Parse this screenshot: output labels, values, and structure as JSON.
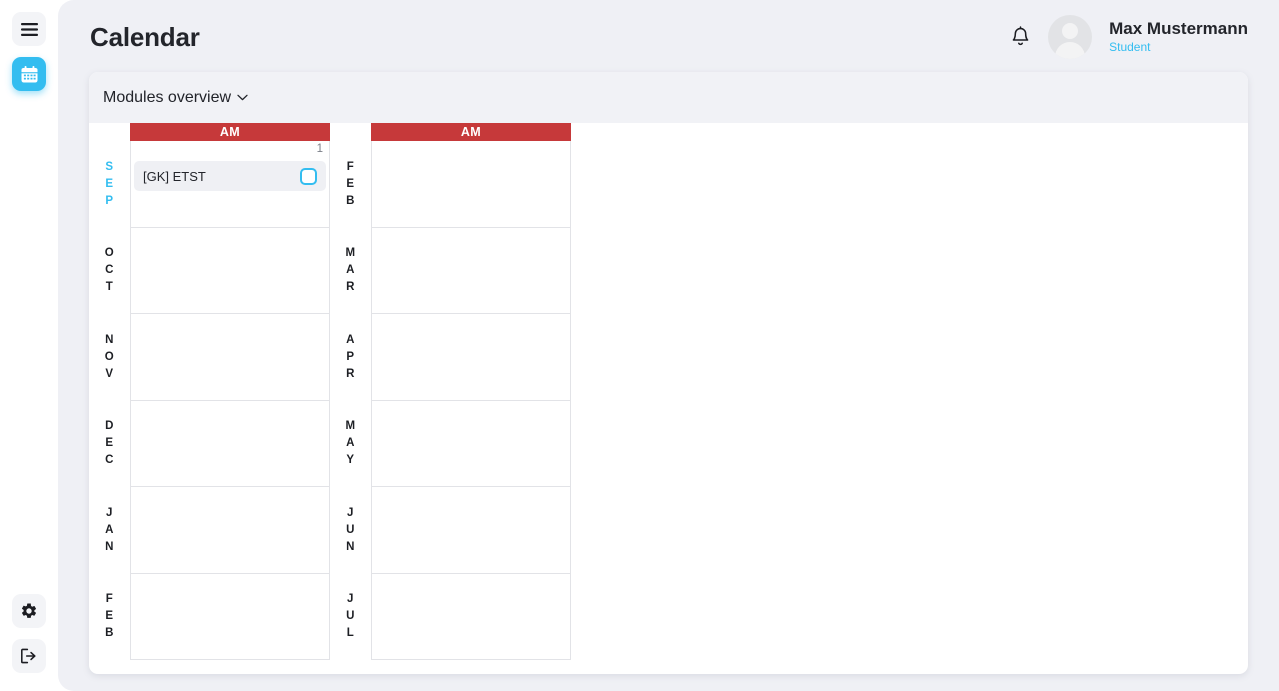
{
  "sidebar": {
    "top_items": [
      {
        "name": "menu-toggle",
        "icon": "hamburger-menu-icon",
        "active": false
      },
      {
        "name": "calendar",
        "icon": "calendar-icon",
        "active": true
      }
    ],
    "bottom_items": [
      {
        "name": "settings",
        "icon": "gear-icon",
        "active": false
      },
      {
        "name": "logout",
        "icon": "logout-icon",
        "active": false
      }
    ]
  },
  "header": {
    "title": "Calendar",
    "notification_icon": "bell-icon",
    "avatar_icon": "user-avatar-icon",
    "user_name": "Max Mustermann",
    "user_role": "Student"
  },
  "card": {
    "selector_label": "Modules overview",
    "selector_chevron": "chevron-down-icon"
  },
  "calendar": {
    "column_header": "AM",
    "groups": [
      {
        "id": "group-left",
        "rows": [
          {
            "month": "SEP",
            "current": true,
            "day_number": "1",
            "events": [
              {
                "label": "[GK] ETST",
                "checked": false
              }
            ]
          },
          {
            "month": "OCT",
            "current": false,
            "day_number": "",
            "events": []
          },
          {
            "month": "NOV",
            "current": false,
            "day_number": "",
            "events": []
          },
          {
            "month": "DEC",
            "current": false,
            "day_number": "",
            "events": []
          },
          {
            "month": "JAN",
            "current": false,
            "day_number": "",
            "events": []
          },
          {
            "month": "FEB",
            "current": false,
            "day_number": "",
            "events": []
          }
        ]
      },
      {
        "id": "group-right",
        "rows": [
          {
            "month": "FEB",
            "current": false,
            "day_number": "",
            "events": []
          },
          {
            "month": "MAR",
            "current": false,
            "day_number": "",
            "events": []
          },
          {
            "month": "APR",
            "current": false,
            "day_number": "",
            "events": []
          },
          {
            "month": "MAY",
            "current": false,
            "day_number": "",
            "events": []
          },
          {
            "month": "JUN",
            "current": false,
            "day_number": "",
            "events": []
          },
          {
            "month": "JUL",
            "current": false,
            "day_number": "",
            "events": []
          }
        ]
      }
    ]
  },
  "colors": {
    "accent_blue": "#33bdf0",
    "header_red": "#c6393a",
    "page_bg": "#eff0f5",
    "chip_bg": "#eff0f4",
    "text_dark": "#23252b"
  }
}
